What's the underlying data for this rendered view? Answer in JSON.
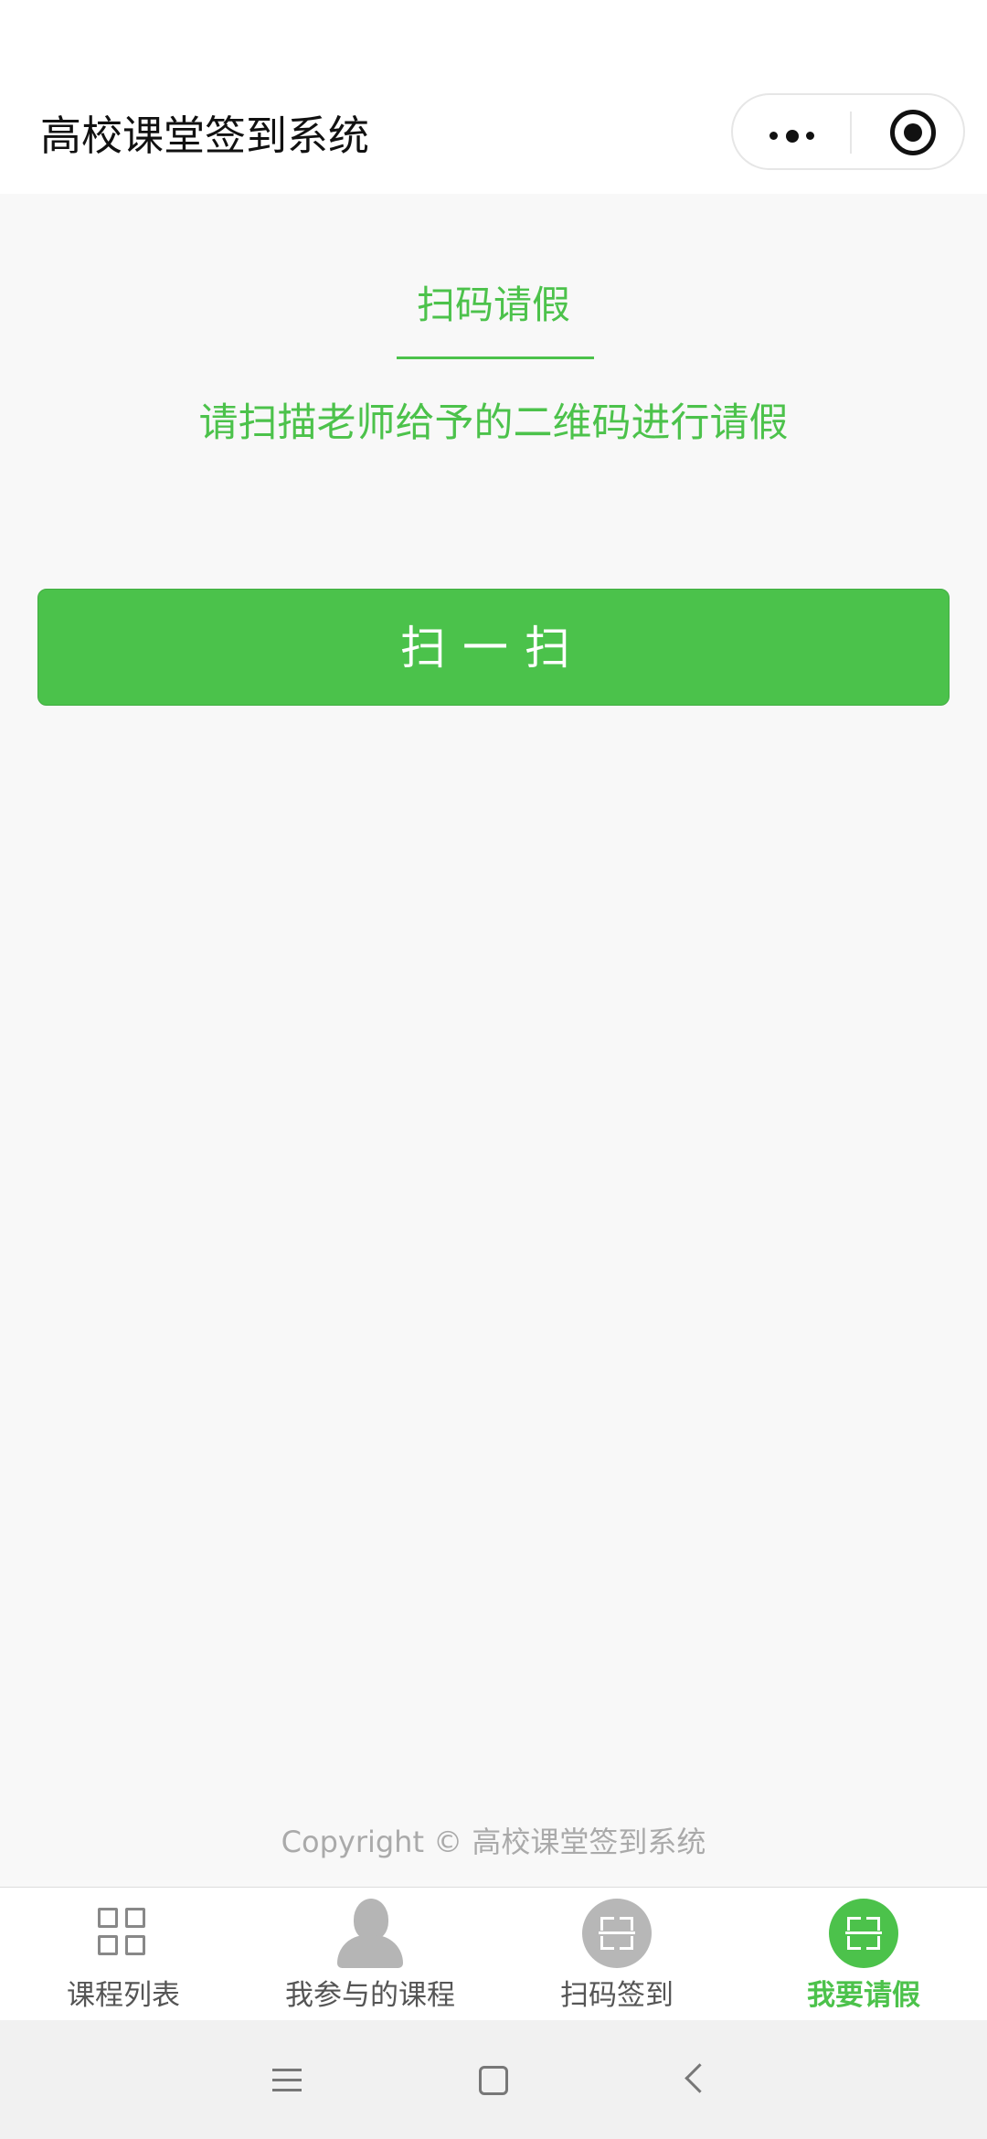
{
  "app": {
    "title": "高校课堂签到系统"
  },
  "capsule": {
    "more_icon": "more-dots-icon",
    "close_icon": "target-circle-icon"
  },
  "leave": {
    "title": "扫码请假",
    "description": "请扫描老师给予的二维码进行请假",
    "scan_button_label": "扫一扫"
  },
  "footer": {
    "copyright": "Copyright © 高校课堂签到系统"
  },
  "tabs": [
    {
      "label": "课程列表",
      "icon": "grid-icon",
      "active": false
    },
    {
      "label": "我参与的课程",
      "icon": "person-icon",
      "active": false
    },
    {
      "label": "扫码签到",
      "icon": "scan-icon",
      "active": false
    },
    {
      "label": "我要请假",
      "icon": "scan-icon",
      "active": true
    }
  ],
  "system_nav": {
    "buttons": [
      "menu-icon",
      "home-icon",
      "back-icon"
    ]
  },
  "colors": {
    "accent": "#4cc24b",
    "button": "#4bc24b",
    "inactive_icon": "#b7b7b7",
    "copyright": "#aaaaaa"
  }
}
